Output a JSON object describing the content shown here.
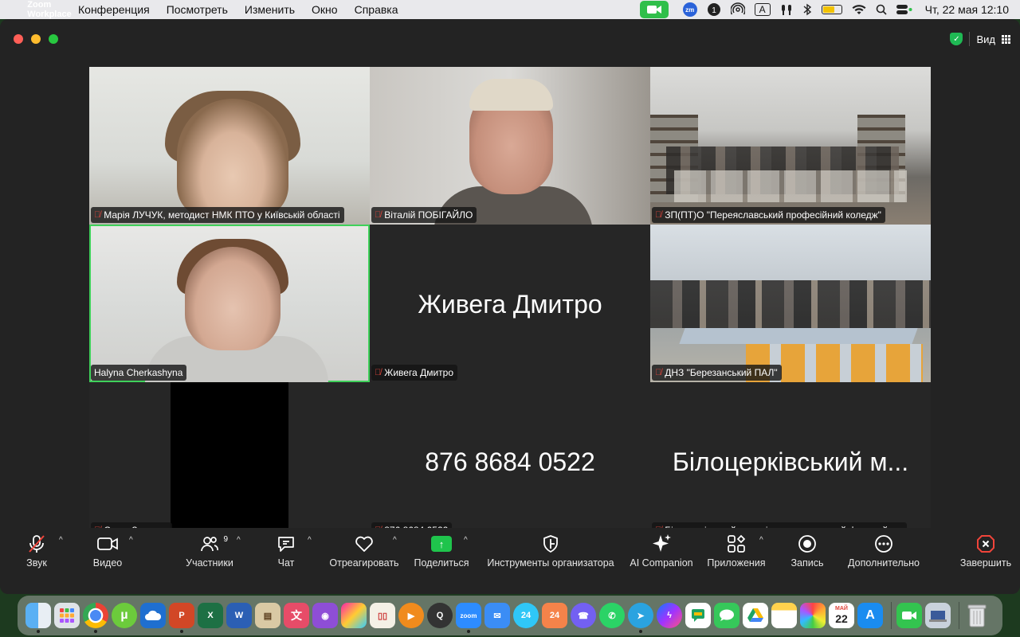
{
  "menubar": {
    "app_name": "Zoom Workplace",
    "items": [
      "Конференция",
      "Посмотреть",
      "Изменить",
      "Окно",
      "Справка"
    ],
    "input_source": "A",
    "datetime": "Чт, 22 мая  12:10"
  },
  "window": {
    "view_label": "Вид"
  },
  "tiles": [
    {
      "name": "Марія ЛУЧУК, методист НМК ПТО у Київській області",
      "muted": true,
      "video": true
    },
    {
      "name": "Віталій ПОБІГАЙЛО",
      "muted": true,
      "video": true
    },
    {
      "name": "ЗП(ПТ)О \"Переяславський професійний коледж\"",
      "muted": true,
      "video": true
    },
    {
      "name": "Halyna Cherkashyna",
      "muted": false,
      "video": true,
      "active_speaker": true
    },
    {
      "name": "Живега Дмитро",
      "muted": true,
      "video": false,
      "display_name": "Живега Дмитро"
    },
    {
      "name": "ДНЗ \"Березанський ПАЛ\"",
      "muted": true,
      "video": true
    },
    {
      "name": "Саша Загляда",
      "muted": true,
      "video": true
    },
    {
      "name": "876 8684 0522",
      "muted": true,
      "video": false,
      "display_name": "876 8684 0522"
    },
    {
      "name": "Білоцерківський механіко - енергетичний фаховий к...",
      "muted": true,
      "video": false,
      "display_name": "Білоцерківський м..."
    }
  ],
  "toolbar": {
    "audio": "Звук",
    "video": "Видео",
    "participants": "Участники",
    "participants_count": "9",
    "chat": "Чат",
    "react": "Отреагировать",
    "share": "Поделиться",
    "host_tools": "Инструменты организатора",
    "ai": "AI Companion",
    "apps": "Приложения",
    "record": "Запись",
    "more": "Дополнительно",
    "end": "Завершить"
  },
  "dock": {
    "calendar_month": "МАЙ",
    "calendar_day": "22",
    "apps": [
      "finder-icon",
      "launchpad-icon",
      "chrome-icon",
      "utorrent-icon",
      "onedrive-icon",
      "powerpoint-icon",
      "excel-icon",
      "word-icon",
      "preview-icon",
      "translate-icon",
      "podcasts-icon",
      "pixelmator-icon",
      "books-icon",
      "vlc-icon",
      "quicktime-icon",
      "zoom-icon",
      "mail-icon",
      "bitrix24-icon",
      "bitrix24-desktop-icon",
      "viber-icon",
      "whatsapp-icon",
      "telegram-icon",
      "messenger-icon",
      "google-chat-icon",
      "messages-icon",
      "google-drive-icon",
      "notes-icon",
      "photos-icon",
      "calendar-icon",
      "app-store-icon",
      "facetime-icon",
      "screenshot-icon",
      "trash-icon"
    ]
  }
}
